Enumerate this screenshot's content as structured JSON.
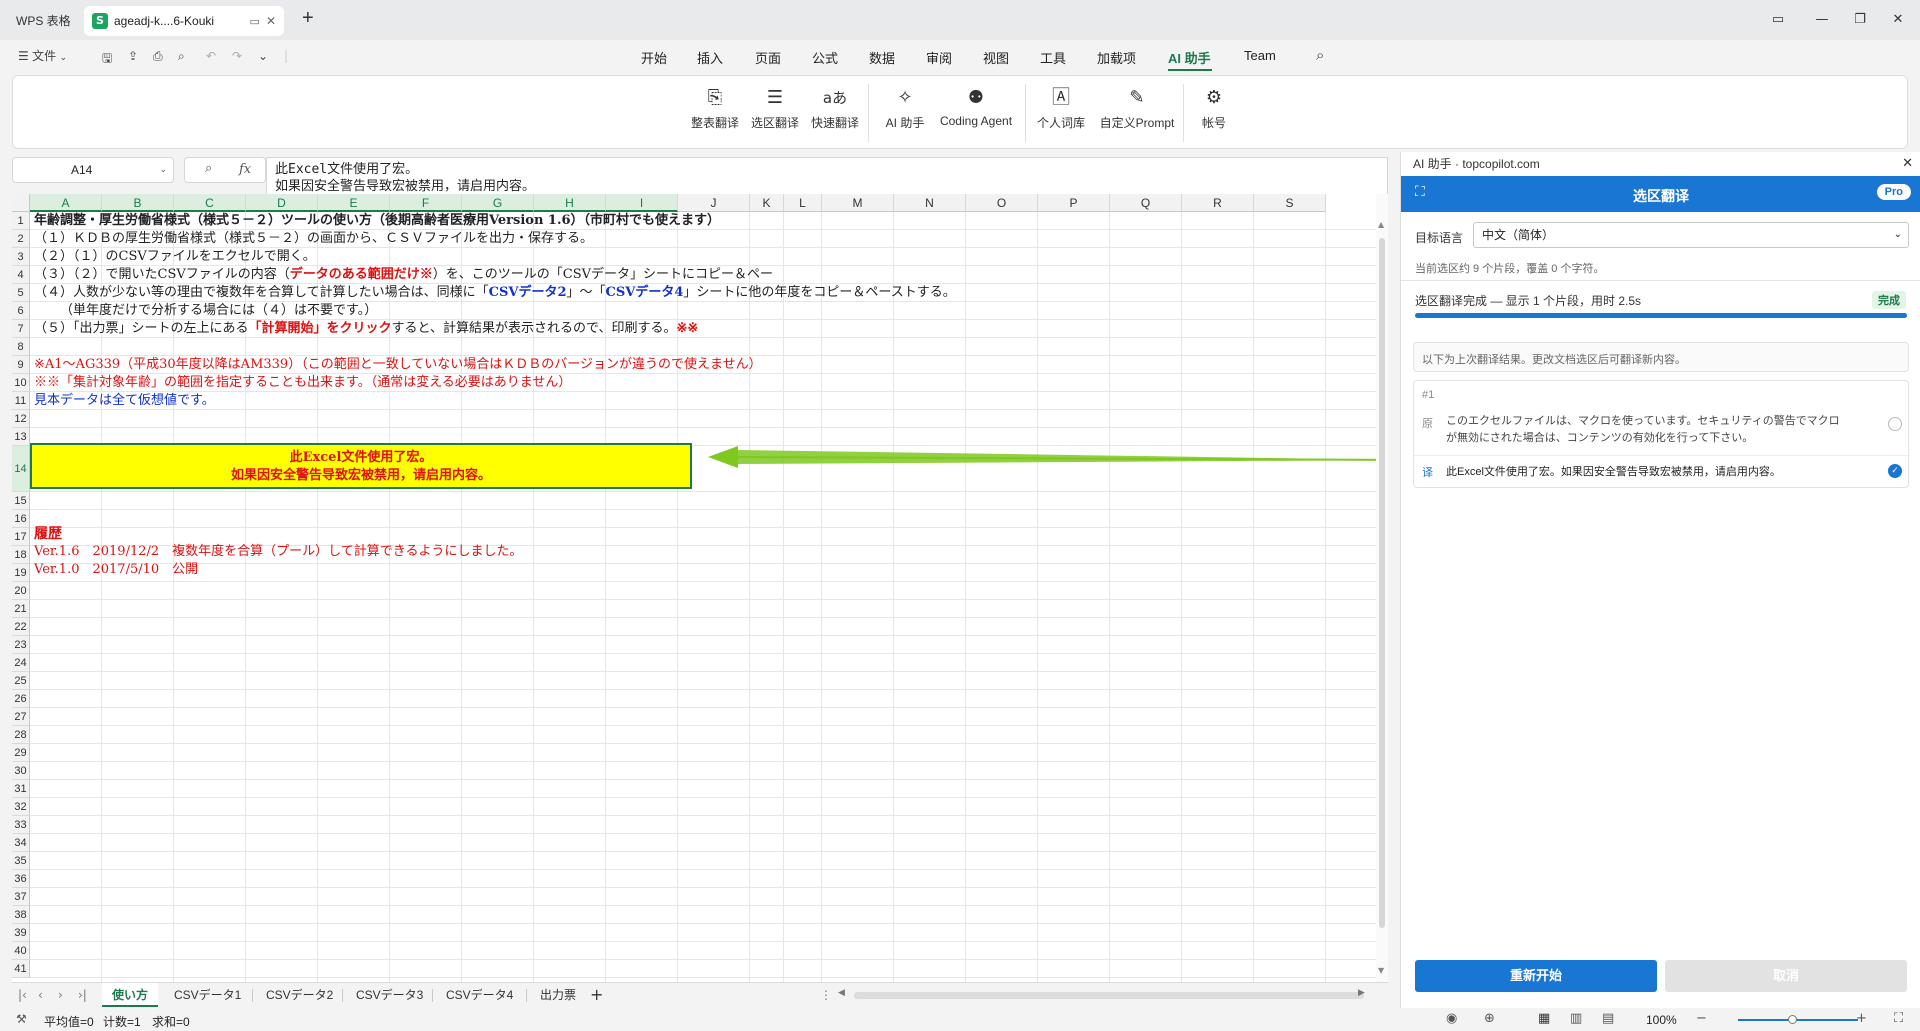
{
  "titlebar": {
    "app_name": "WPS 表格",
    "doc_tab": "ageadj-k....6-Kouki",
    "new_tab": "+"
  },
  "menu": {
    "file": "文件",
    "tabs": [
      "开始",
      "插入",
      "页面",
      "公式",
      "数据",
      "审阅",
      "视图",
      "工具",
      "加载项",
      "AI 助手",
      "Team"
    ],
    "active_tab": "AI 助手"
  },
  "ribbon": {
    "buttons": [
      "整表翻译",
      "选区翻译",
      "快速翻译",
      "AI 助手",
      "Coding Agent",
      "个人词库",
      "自定义Prompt",
      "帐号"
    ]
  },
  "formula_bar": {
    "cell_ref": "A14",
    "fx": "fx",
    "line1": "此Excel文件使用了宏。",
    "line2": "如果因安全警告导致宏被禁用，请启用内容。"
  },
  "sheet": {
    "columns": [
      "A",
      "B",
      "C",
      "D",
      "E",
      "F",
      "G",
      "H",
      "I",
      "J",
      "K",
      "L",
      "M",
      "N",
      "O",
      "P",
      "Q",
      "R",
      "S"
    ],
    "rows": [
      "1",
      "2",
      "3",
      "4",
      "5",
      "6",
      "7",
      "8",
      "9",
      "10",
      "11",
      "12",
      "13",
      "14",
      "15",
      "16",
      "17",
      "18",
      "19",
      "20",
      "21",
      "22",
      "23",
      "24",
      "25",
      "26",
      "27",
      "28",
      "29",
      "30",
      "31",
      "32",
      "33",
      "34",
      "35",
      "36",
      "37",
      "38",
      "39",
      "40",
      "41"
    ],
    "r1": "年齢調整・厚生労働省様式（様式５－２）ツールの使い方（後期高齢者医療用Version 1.6）（市町村でも使えます）",
    "r2": "（１）ＫＤＢの厚生労働省様式（様式５－２）の画面から、ＣＳＶファイルを出力・保存する。",
    "r3": "（２）（１）のCSVファイルをエクセルで開く。",
    "r4_a": "（３）（２）で開いたCSVファイルの内容（",
    "r4_b": "データのある範囲だけ※",
    "r4_c": "）を、このツールの「CSVデータ」シートにコピー＆ペー",
    "r5_a": "（４）人数が少ない等の理由で複数年を合算して計算したい場合は、同様に「",
    "r5_b": "CSVデータ2",
    "r5_c": "」～「",
    "r5_d": "CSVデータ4",
    "r5_e": "」シートに他の年度をコピー＆ペーストする。",
    "r6": "（単年度だけで分析する場合には（４）は不要です。）",
    "r7_a": "（５）「出力票」シートの左上にある",
    "r7_b": "「計算開始」をクリック",
    "r7_c": "すると、計算結果が表示されるので、印刷する。",
    "r7_d": "※※",
    "r9": "※A1～AG339（平成30年度以降はAM339）（この範囲と一致していない場合はＫＤＢのバージョンが違うので使えません）",
    "r10": "※※「集計対象年齢」の範囲を指定することも出来ます。（通常は変える必要はありません）",
    "r11": "見本データは全て仮想値です。",
    "a14_line1": "此Excel文件使用了宏。",
    "a14_line2": "如果因安全警告导致宏被禁用，请启用内容。",
    "r17": "履歴",
    "r18": "Ver.1.6　2019/12/2　複数年度を合算（プール）して計算できるようにしました。",
    "r19": "Ver.1.0　2017/5/10　公開"
  },
  "sheet_tabs": [
    "使い方",
    "CSVデータ1",
    "CSVデータ2",
    "CSVデータ3",
    "CSVデータ4",
    "出力票"
  ],
  "active_sheet": "使い方",
  "statusbar": {
    "average": "平均值=0",
    "count": "计数=1",
    "sum": "求和=0",
    "zoom": "100%"
  },
  "panel": {
    "window_title": "AI 助手 · topcopilot.com",
    "header_title": "选区翻译",
    "pro_badge": "Pro",
    "target_lang_label": "目标语言",
    "target_lang_value": "中文（简体）",
    "selection_info": "当前选区约 9 个片段，覆盖 0 个字符。",
    "status_text": "选区翻译完成 — 显示 1 个片段，用时 2.5s",
    "status_badge": "完成",
    "progress": 1.0,
    "notice": "以下为上次翻译结果。更改文档选区后可翻译新内容。",
    "result": {
      "index": "#1",
      "orig_tag": "原",
      "orig_text_1": "このエクセルファイルは、マクロを使っています。セキュリティの警告でマクロ",
      "orig_text_2": "が無効にされた場合は、コンテンツの有効化を行って下さい。",
      "trans_tag": "译",
      "trans_text": "此Excel文件使用了宏。如果因安全警告导致宏被禁用，请启用内容。"
    },
    "restart_button": "重新开始",
    "cancel_button": "取消"
  },
  "colors": {
    "accent_green": "#1d7a4c",
    "panel_blue": "#1976d2",
    "red_text": "#e01010",
    "blue_text": "#1030d0",
    "highlight_yellow": "#ffff00",
    "arrow_green": "#7ec820"
  }
}
